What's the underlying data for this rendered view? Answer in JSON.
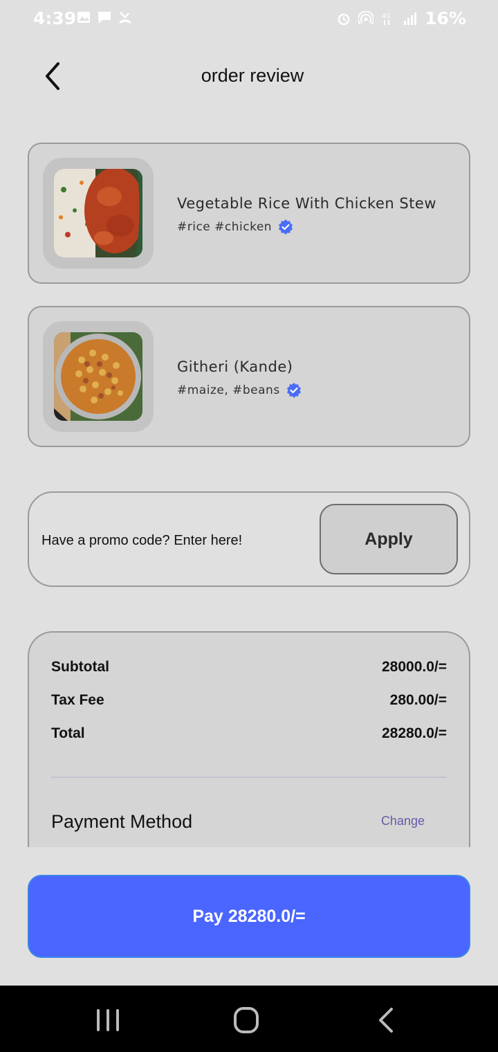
{
  "status_bar": {
    "time": "4:39",
    "battery": "16%",
    "left_icons": [
      "image-icon",
      "chat-icon",
      "missed-call-icon"
    ],
    "right_icons": [
      "alarm-icon",
      "hotspot-icon",
      "4g-icon",
      "signal-icon",
      "battery-icon"
    ]
  },
  "header": {
    "title": "order review",
    "back_icon": "chevron-left-icon"
  },
  "items": [
    {
      "name": "Vegetable Rice With Chicken Stew",
      "tags": "#rice #chicken",
      "badge_icon": "verified-icon"
    },
    {
      "name": "Githeri (Kande)",
      "tags": "#maize, #beans",
      "badge_icon": "verified-icon"
    }
  ],
  "promo": {
    "prompt": "Have a promo code? Enter here!",
    "apply_label": "Apply"
  },
  "summary": {
    "subtotal_label": "Subtotal",
    "subtotal_value": "28000.0/=",
    "tax_label": "Tax Fee",
    "tax_value": "280.00/=",
    "total_label": "Total",
    "total_value": "28280.0/=",
    "payment_label": "Payment Method",
    "change_label": "Change"
  },
  "pay": {
    "label": "Pay 28280.0/="
  },
  "colors": {
    "accent": "#4a66ff",
    "verified": "#4a6cf7",
    "change_link": "#6a5aa8",
    "background": "#e0e0e0",
    "card": "#d5d5d5"
  },
  "nav": {
    "icons": [
      "recent-apps-icon",
      "home-icon",
      "back-icon"
    ]
  }
}
